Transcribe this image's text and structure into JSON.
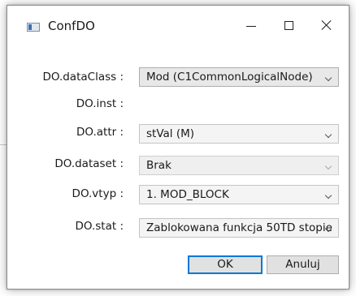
{
  "window": {
    "title": "ConfDO",
    "controls": [
      "minimize",
      "maximize",
      "close"
    ]
  },
  "form": {
    "dataClass": {
      "label": "DO.dataClass :",
      "value": "Mod (C1CommonLogicalNode)"
    },
    "inst": {
      "label": "DO.inst :"
    },
    "attr": {
      "label": "DO.attr :",
      "value": "stVal (M)"
    },
    "dataset": {
      "label": "DO.dataset :",
      "value": "Brak",
      "disabled": true
    },
    "vtyp": {
      "label": "DO.vtyp :",
      "value": "1. MOD_BLOCK"
    },
    "stat": {
      "label": "DO.stat :",
      "value": "Zablokowana funkcja 50TD stopie"
    }
  },
  "buttons": {
    "ok": "OK",
    "cancel": "Anuluj"
  },
  "colors": {
    "focus_border": "#0078d7",
    "combo_bg": "#e8e8e8",
    "button_bg": "#e1e1e1"
  },
  "icons": {
    "app": "app-window-icon",
    "dropdown": "chevron-down-icon"
  }
}
